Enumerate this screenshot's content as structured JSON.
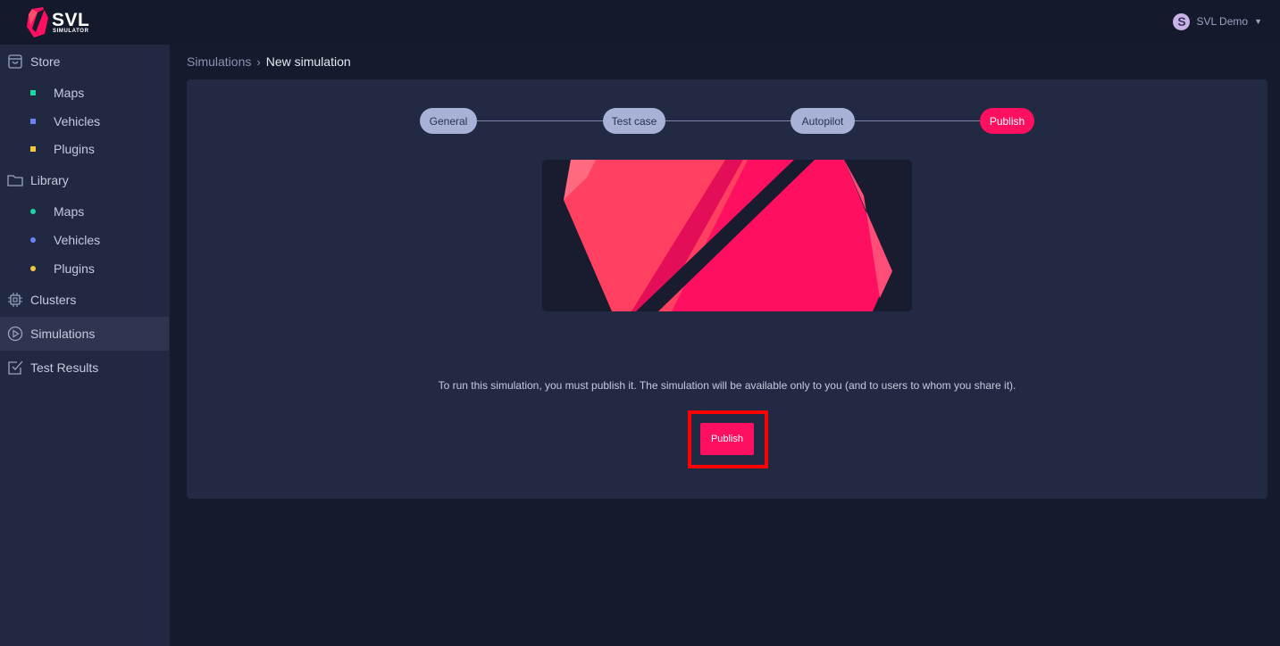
{
  "header": {
    "logo_word": "SVL",
    "logo_sub": "SIMULATOR",
    "user_initial": "S",
    "user_name": "SVL Demo",
    "user_caret": "▼"
  },
  "sidebar": {
    "store": {
      "label": "Store",
      "icon": "shopping-bag-icon",
      "items": [
        {
          "label": "Maps",
          "color": "#1fd3a5"
        },
        {
          "label": "Vehicles",
          "color": "#6a82f5"
        },
        {
          "label": "Plugins",
          "color": "#f5c542"
        }
      ]
    },
    "library": {
      "label": "Library",
      "icon": "folder-icon",
      "items": [
        {
          "label": "Maps",
          "color": "#1fd3a5"
        },
        {
          "label": "Vehicles",
          "color": "#6a82f5"
        },
        {
          "label": "Plugins",
          "color": "#f5c542"
        }
      ]
    },
    "clusters": {
      "label": "Clusters",
      "icon": "chip-icon"
    },
    "simulations": {
      "label": "Simulations",
      "icon": "play-circle-icon",
      "active": true
    },
    "test_results": {
      "label": "Test Results",
      "icon": "checkbox-icon"
    }
  },
  "breadcrumb": {
    "parent": "Simulations",
    "separator": "›",
    "current": "New simulation"
  },
  "stepper": {
    "steps": [
      {
        "label": "General",
        "active": false
      },
      {
        "label": "Test case",
        "active": false
      },
      {
        "label": "Autopilot",
        "active": false
      },
      {
        "label": "Publish",
        "active": true
      }
    ]
  },
  "main": {
    "info_text": "To run this simulation, you must publish it. The simulation will be available only to you (and to users to whom you share it).",
    "publish_button": "Publish"
  },
  "colors": {
    "accent": "#ff0f5f",
    "step_inactive": "#a7b2d6",
    "highlight_box": "#ff0000"
  }
}
